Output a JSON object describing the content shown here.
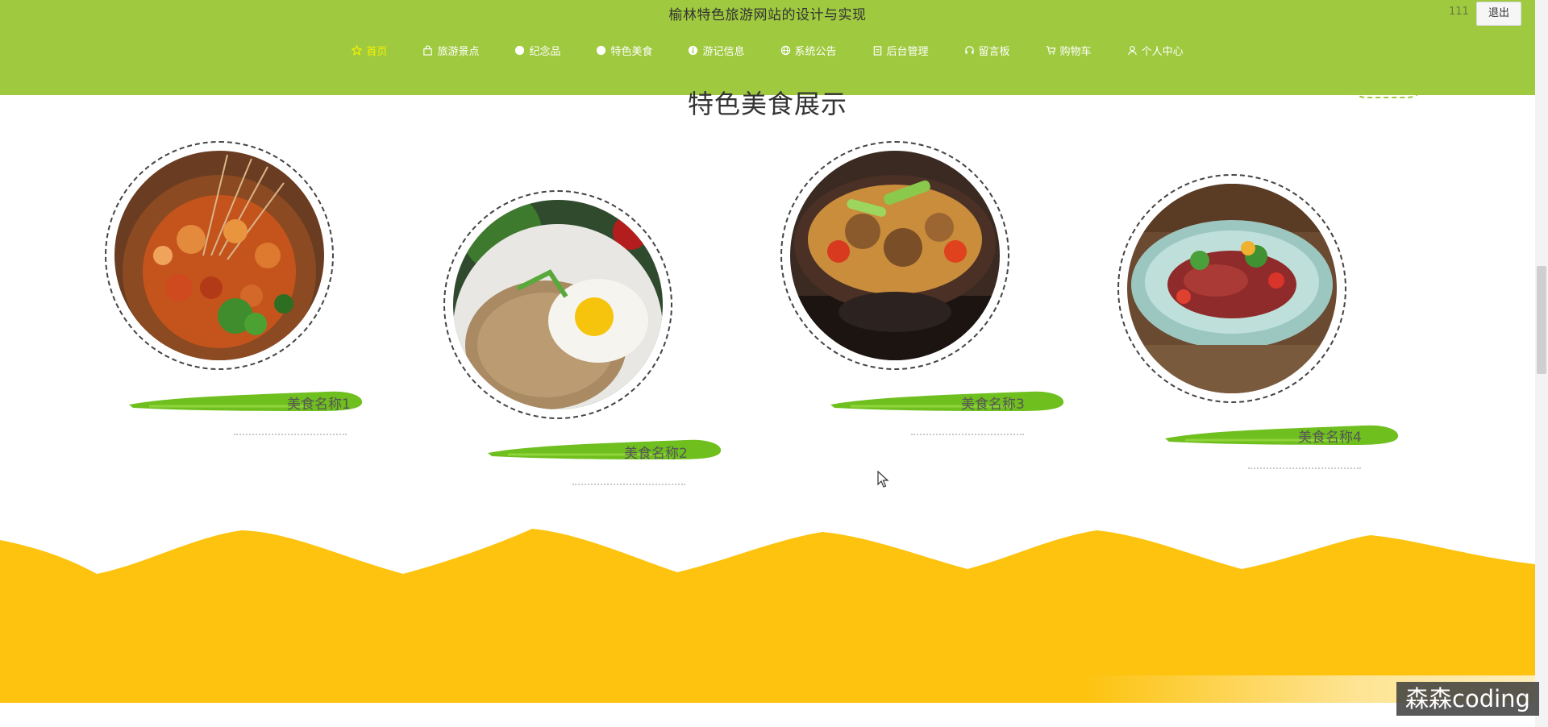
{
  "header": {
    "site_title": "榆林特色旅游网站的设计与实现",
    "user_name": "111",
    "logout_label": "退出",
    "bg_color": "#9fc93f",
    "nav": [
      {
        "label": "首页",
        "icon": "star-icon",
        "active": true
      },
      {
        "label": "旅游景点",
        "icon": "bag-icon",
        "active": false
      },
      {
        "label": "纪念品",
        "icon": "circle-icon",
        "active": false
      },
      {
        "label": "特色美食",
        "icon": "circle-icon",
        "active": false
      },
      {
        "label": "游记信息",
        "icon": "info-icon",
        "active": false
      },
      {
        "label": "系统公告",
        "icon": "globe-icon",
        "active": false
      },
      {
        "label": "后台管理",
        "icon": "clipboard-icon",
        "active": false
      },
      {
        "label": "留言板",
        "icon": "headset-icon",
        "active": false
      },
      {
        "label": "购物车",
        "icon": "cart-icon",
        "active": false
      },
      {
        "label": "个人中心",
        "icon": "user-icon",
        "active": false
      }
    ]
  },
  "section": {
    "title": "特色美食展示",
    "foods": [
      {
        "name": "美食名称1",
        "image": "skewers-seafood-bowl"
      },
      {
        "name": "美食名称2",
        "image": "fried-rice-egg"
      },
      {
        "name": "美食名称3",
        "image": "stirfry-pan"
      },
      {
        "name": "美食名称4",
        "image": "beef-salad-plate"
      }
    ]
  },
  "footer": {
    "wave_color": "#fdc30f"
  },
  "watermark": "森森coding"
}
